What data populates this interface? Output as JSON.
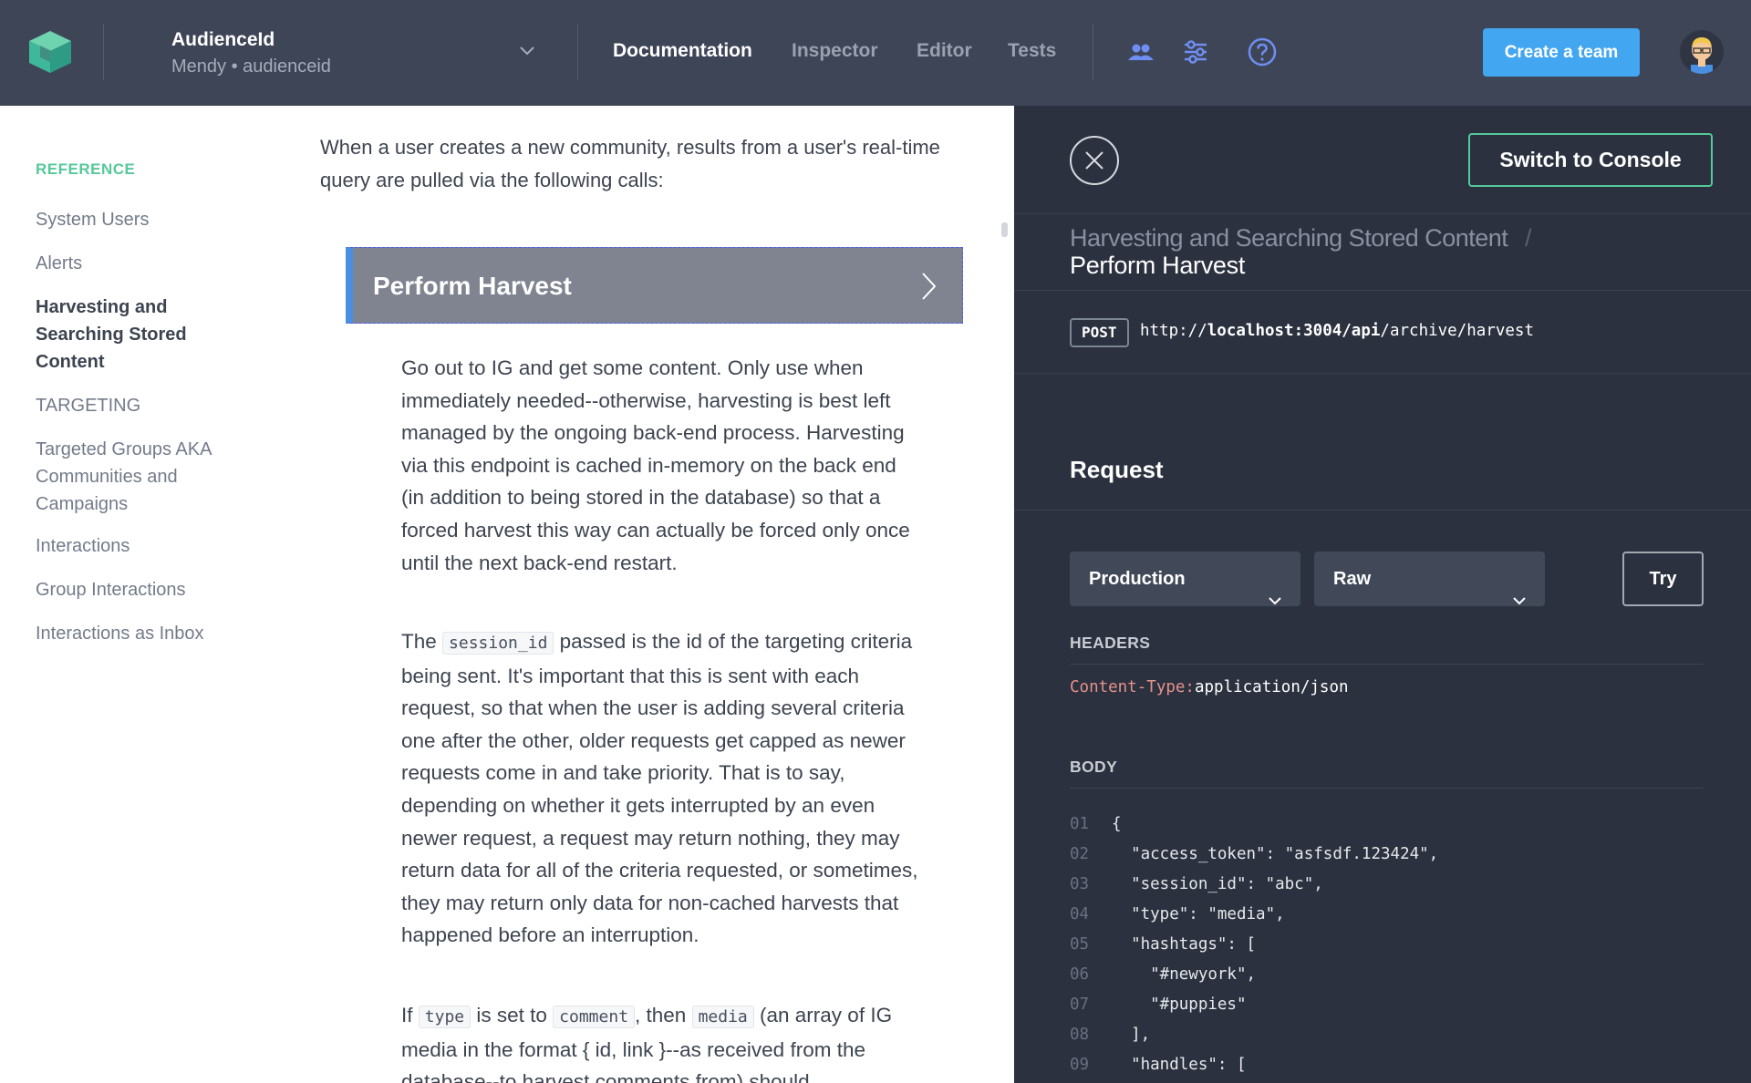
{
  "colors": {
    "topbar": "#3e4557",
    "accent_green": "#56c89a",
    "button_blue": "#43a6f1",
    "console_bg": "#2b313f",
    "header_key": "#e4938a"
  },
  "header": {
    "logo_icon": "cube-logo-icon",
    "project_name": "AudienceId",
    "project_sub": "Mendy • audienceid",
    "nav": [
      {
        "label": "Documentation",
        "active": true
      },
      {
        "label": "Inspector"
      },
      {
        "label": "Editor"
      },
      {
        "label": "Tests"
      }
    ],
    "tool_icons": [
      "users-icon",
      "sliders-icon",
      "help-icon"
    ],
    "create_team_label": "Create a team"
  },
  "sidebar": {
    "heading": "REFERENCE",
    "items": [
      {
        "label": "System Users"
      },
      {
        "label": "Alerts"
      },
      {
        "label": "Harvesting and Searching Stored Content",
        "active": true
      },
      {
        "label": "TARGETING"
      },
      {
        "label": "Targeted Groups AKA Communities and Campaigns"
      },
      {
        "label": "Interactions"
      },
      {
        "label": "Group Interactions"
      },
      {
        "label": "Interactions as Inbox"
      }
    ]
  },
  "doc": {
    "intro": "When a user creates a new community, results from a user's real-time query are pulled via the following calls:",
    "endpoint_title": "Perform Harvest",
    "para1": "Go out to IG and get some content. Only use when immediately needed--otherwise, harvesting is best left managed by the ongoing back-end process. Harvesting via this endpoint is cached in-memory on the back end (in addition to being stored in the database) so that a forced harvest this way can actually be forced only once until the next back-end restart.",
    "para2": {
      "t1": "The ",
      "code1": "session_id",
      "t2": " passed is the id of the targeting criteria being sent. It's important that this is sent with each request, so that when the user is adding several criteria one after the other, older requests get capped as newer requests come in and take priority. That is to say, depending on whether it gets interrupted by an even newer request, a request may return nothing, they may return data for all of the criteria requested, or sometimes, they may return only data for non-cached harvests that happened before an interruption."
    },
    "para3": {
      "t1": "If ",
      "code1": "type",
      "t2": " is set to ",
      "code2": "comment",
      "t3": ", then ",
      "code3": "media",
      "t4": " (an array of IG media in the format { id, link }--as received from the database--to harvest comments from) should"
    }
  },
  "console": {
    "switch_label": "Switch to Console",
    "breadcrumb_parent": "Harvesting and Searching Stored Content",
    "breadcrumb_sep": "/",
    "breadcrumb_current": "Perform Harvest",
    "method": "POST",
    "url_prefix": "http://",
    "url_host": "localhost:3004/api",
    "url_path": "/archive/harvest",
    "request_title": "Request",
    "env_select": "Production",
    "format_select": "Raw",
    "try_label": "Try",
    "headers_label": "HEADERS",
    "header_key": "Content-Type:",
    "header_value": "application/json",
    "body_label": "BODY",
    "body_lines": [
      {
        "n": "01",
        "t": "{"
      },
      {
        "n": "02",
        "t": "  \"access_token\": \"asfsdf.123424\","
      },
      {
        "n": "03",
        "t": "  \"session_id\": \"abc\","
      },
      {
        "n": "04",
        "t": "  \"type\": \"media\","
      },
      {
        "n": "05",
        "t": "  \"hashtags\": ["
      },
      {
        "n": "06",
        "t": "    \"#newyork\","
      },
      {
        "n": "07",
        "t": "    \"#puppies\""
      },
      {
        "n": "08",
        "t": "  ],"
      },
      {
        "n": "09",
        "t": "  \"handles\": ["
      }
    ]
  }
}
